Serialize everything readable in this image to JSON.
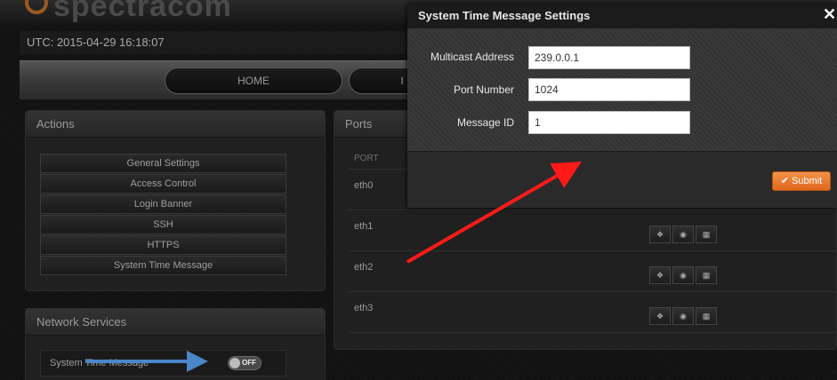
{
  "header": {
    "logo_text": "spectracom",
    "utc_text": "UTC: 2015-04-29 16:18:07",
    "nav": [
      {
        "label": "HOME"
      },
      {
        "label": "I"
      }
    ]
  },
  "actions": {
    "title": "Actions",
    "items": [
      {
        "label": "General Settings"
      },
      {
        "label": "Access Control"
      },
      {
        "label": "Login Banner"
      },
      {
        "label": "SSH"
      },
      {
        "label": "HTTPS"
      },
      {
        "label": "System Time Message"
      }
    ]
  },
  "network_services": {
    "title": "Network Services",
    "rows": [
      {
        "label": "System Time Message",
        "toggle": "OFF"
      }
    ]
  },
  "ports": {
    "title": "Ports",
    "column_header": "PORT",
    "rows": [
      {
        "name": "eth0"
      },
      {
        "name": "eth1"
      },
      {
        "name": "eth2"
      },
      {
        "name": "eth3"
      }
    ],
    "button_icons": [
      "info-icon",
      "gear-icon",
      "grid-icon"
    ]
  },
  "modal": {
    "title": "System Time Message Settings",
    "close_label": "✕",
    "fields": [
      {
        "label": "Multicast Address",
        "value": "239.0.0.1"
      },
      {
        "label": "Port Number",
        "value": "1024"
      },
      {
        "label": "Message ID",
        "value": "1"
      }
    ],
    "submit_label": "✔ Submit"
  },
  "colors": {
    "accent_orange": "#e8742a",
    "annotation_red": "#ff1a1a",
    "annotation_blue": "#4a86c8"
  }
}
